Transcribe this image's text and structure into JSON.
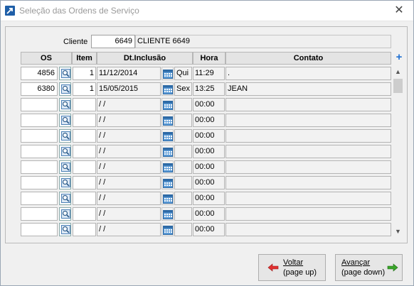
{
  "window": {
    "title": "Seleção das Ordens de Serviço",
    "close_glyph": "✕"
  },
  "cliente": {
    "label": "Cliente",
    "code": "6649",
    "name": "CLIENTE 6649"
  },
  "table": {
    "headers": {
      "os": "OS",
      "item": "Item",
      "dt_inclusao": "Dt.Inclusão",
      "hora": "Hora",
      "contato": "Contato"
    },
    "add_glyph": "+",
    "rows": [
      {
        "os": "4856",
        "item": "1",
        "date": "11/12/2014",
        "dow": "Qui",
        "hora": "11:29",
        "contato": "."
      },
      {
        "os": "6380",
        "item": "1",
        "date": "15/05/2015",
        "dow": "Sex",
        "hora": "13:25",
        "contato": "JEAN"
      },
      {
        "os": "",
        "item": "",
        "date": " / /",
        "dow": "",
        "hora": "00:00",
        "contato": ""
      },
      {
        "os": "",
        "item": "",
        "date": " / /",
        "dow": "",
        "hora": "00:00",
        "contato": ""
      },
      {
        "os": "",
        "item": "",
        "date": " / /",
        "dow": "",
        "hora": "00:00",
        "contato": ""
      },
      {
        "os": "",
        "item": "",
        "date": " / /",
        "dow": "",
        "hora": "00:00",
        "contato": ""
      },
      {
        "os": "",
        "item": "",
        "date": " / /",
        "dow": "",
        "hora": "00:00",
        "contato": ""
      },
      {
        "os": "",
        "item": "",
        "date": " / /",
        "dow": "",
        "hora": "00:00",
        "contato": ""
      },
      {
        "os": "",
        "item": "",
        "date": " / /",
        "dow": "",
        "hora": "00:00",
        "contato": ""
      },
      {
        "os": "",
        "item": "",
        "date": " / /",
        "dow": "",
        "hora": "00:00",
        "contato": ""
      },
      {
        "os": "",
        "item": "",
        "date": " / /",
        "dow": "",
        "hora": "00:00",
        "contato": ""
      }
    ]
  },
  "scrollbar": {
    "up_glyph": "▲",
    "down_glyph": "▼"
  },
  "buttons": {
    "voltar": {
      "label": "Voltar",
      "hint": "(page up)",
      "icon": "left-arrow-icon",
      "color": "#e03030"
    },
    "avancar": {
      "label": "Avançar",
      "hint": "(page down)",
      "icon": "right-arrow-icon",
      "color": "#3aa52a"
    }
  },
  "colors": {
    "accent": "#1e6fd2"
  }
}
